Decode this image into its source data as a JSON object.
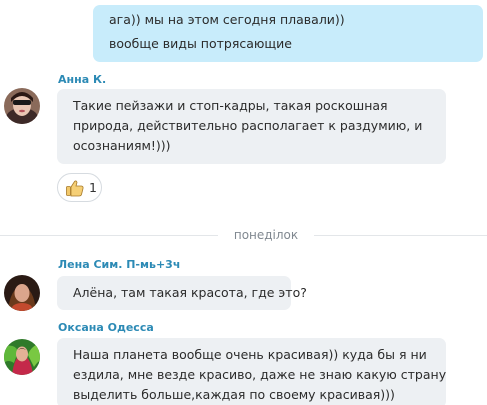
{
  "messages": [
    {
      "kind": "outgoing",
      "lines": [
        "ага)) мы на этом сегодня плавали))",
        "вообще виды потрясающие"
      ]
    },
    {
      "kind": "incoming",
      "sender": "Анна К.",
      "lines": [
        "Такие пейзажи и стоп-кадры, такая роскошная",
        "природа,  действительно располагает к раздумию, и",
        "осознаниям!)))"
      ],
      "reaction": {
        "icon": "thumbs-up-icon",
        "count": "1"
      }
    },
    {
      "kind": "incoming",
      "sender": "Лена Сим. П-мь+3ч",
      "lines": [
        "Алёна,  там такая красота, где это?"
      ]
    },
    {
      "kind": "incoming",
      "sender": "Оксана Одесса",
      "lines": [
        "Наша планета вообще очень красивая)) куда бы я ни",
        "ездила, мне везде красиво, даже не знаю какую страну",
        "выделить больше,каждая по своему красивая)))"
      ]
    }
  ],
  "day_separator": "понеділок",
  "colors": {
    "outgoing_bubble": "#c8ecfb",
    "incoming_bubble": "#edf0f3",
    "sender_name": "#2c8ab5",
    "separator_text": "#808890"
  }
}
